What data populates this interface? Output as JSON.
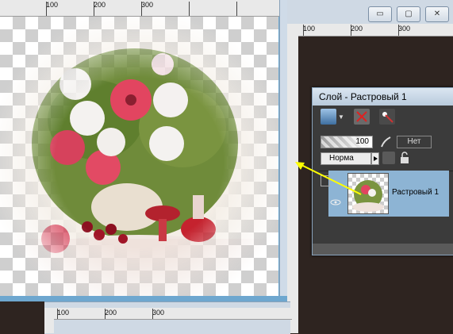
{
  "document_window": {
    "ruler_labels": [
      "100",
      "200",
      "300"
    ]
  },
  "right_window": {
    "ruler_labels": [
      "100",
      "200",
      "300"
    ],
    "controls": {
      "minimize": "▭",
      "maximize": "▢",
      "close": "✕"
    }
  },
  "bottom_window": {
    "ruler_labels": [
      "100",
      "200",
      "300"
    ]
  },
  "layers_palette": {
    "title": "Слой - Растровый 1",
    "opacity_value": "100",
    "mask_label": "Нет",
    "blend_mode": "Норма",
    "layer_name": "Растровый 1"
  },
  "colors": {
    "desktop_bg": "#2e2420",
    "window_frame": "#6ea7cf",
    "selected_layer": "#8db4d4",
    "arrow": "#ffff00"
  }
}
